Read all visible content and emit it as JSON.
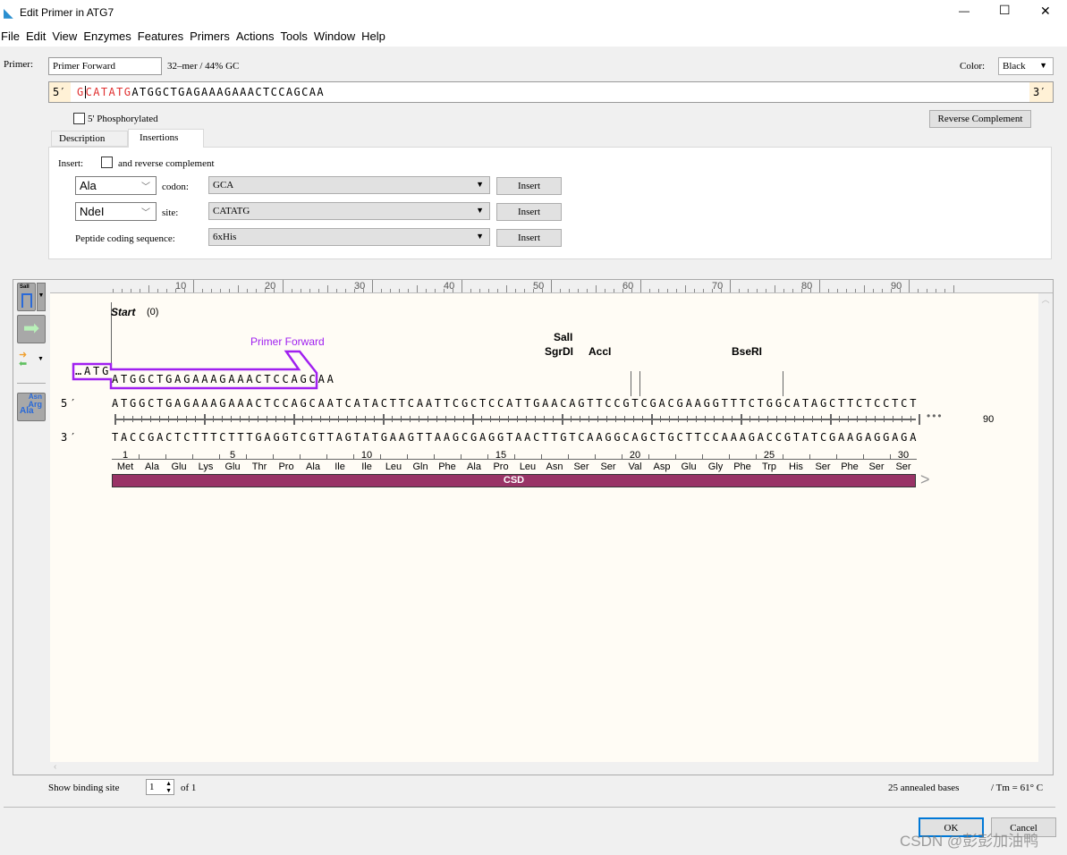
{
  "window": {
    "title": "Edit Primer in ATG7",
    "minimize": "—",
    "maximize": "☐",
    "close": "✕"
  },
  "menu": [
    "File",
    "Edit",
    "View",
    "Enzymes",
    "Features",
    "Primers",
    "Actions",
    "Tools",
    "Window",
    "Help"
  ],
  "primer": {
    "label": "Primer:",
    "name": "Primer Forward",
    "stats": "32–mer  /  44% GC",
    "color_label": "Color:",
    "color_value": "Black",
    "five_prime": "5′",
    "three_prime": "3′",
    "seq_red1": "G",
    "seq_red2": "CATATG",
    "seq_rest": "ATGGCTGAGAAAGAAACTCCAGCAA",
    "phosphorylated_label": "5' Phosphorylated",
    "reverse_complement": "Reverse Complement",
    "insert_color": "#e03030"
  },
  "tabs": {
    "description": "Description",
    "insertions": "Insertions"
  },
  "insertions": {
    "insert_label": "Insert:",
    "rc_label": "and reverse complement",
    "rows": [
      {
        "select": "Ala",
        "label": "codon:",
        "value": "GCA",
        "button": "Insert"
      },
      {
        "select": "NdeI",
        "label": "site:",
        "value": "CATATG",
        "button": "Insert"
      },
      {
        "select": "",
        "label": "Peptide coding sequence:",
        "value": "6xHis",
        "button": "Insert"
      }
    ]
  },
  "toolbar": {
    "enzyme_icon_label": "SalI",
    "aa_icon": [
      "Asn",
      "Arg",
      "Ala"
    ]
  },
  "ruler": [
    "10",
    "20",
    "30",
    "40",
    "50",
    "60",
    "70",
    "80",
    "90"
  ],
  "map": {
    "start_label": "Start",
    "start_pos": "(0)",
    "primer_name": "Primer Forward",
    "primer_overhang": "…ATG",
    "primer_annealed": "ATGGCTGAGAAAGAAACTCCAGCAA",
    "primer_color": "#a020f0",
    "five": "5′",
    "three": "3′",
    "top_seq": "ATGGCTGAGAAAGAAACTCCAGCAATCATACTTCAATTCGCTCCATTGAACAGTTCCGTCGACGAAGGTTTCTGGCATAGCTTCTCCTCT",
    "bottom_seq": "TACCGACTCTTTCTTTGAGGTCGTTAGTATGAAGTTAAGCGAGGTAACTTGTCAAGGCAGCTGCTTCCAAAGACCGTATCGAAGAGGAGA",
    "ellipsis": "•••",
    "end_num": "90",
    "enzymes": [
      {
        "name": "SalI",
        "pos": 58
      },
      {
        "name": "SgrDI",
        "pos": 58
      },
      {
        "name": "AccI",
        "pos": 59
      },
      {
        "name": "BseRI",
        "pos": 75
      }
    ],
    "aa_numbers": [
      "1",
      "5",
      "10",
      "15",
      "20",
      "25",
      "30"
    ],
    "aa": [
      "Met",
      "Ala",
      "Glu",
      "Lys",
      "Glu",
      "Thr",
      "Pro",
      "Ala",
      "Ile",
      "Ile",
      "Leu",
      "Gln",
      "Phe",
      "Ala",
      "Pro",
      "Leu",
      "Asn",
      "Ser",
      "Ser",
      "Val",
      "Asp",
      "Glu",
      "Gly",
      "Phe",
      "Trp",
      "His",
      "Ser",
      "Phe",
      "Ser",
      "Ser"
    ],
    "feature": "CSD",
    "feature_color": "#993366"
  },
  "footer": {
    "show_binding": "Show binding site",
    "site_value": "1",
    "of": "of 1",
    "annealed": "25 annealed bases",
    "tm": "/ Tm = 61° C",
    "ok": "OK",
    "cancel": "Cancel"
  },
  "watermark": "CSDN @彭彭加油鸭"
}
